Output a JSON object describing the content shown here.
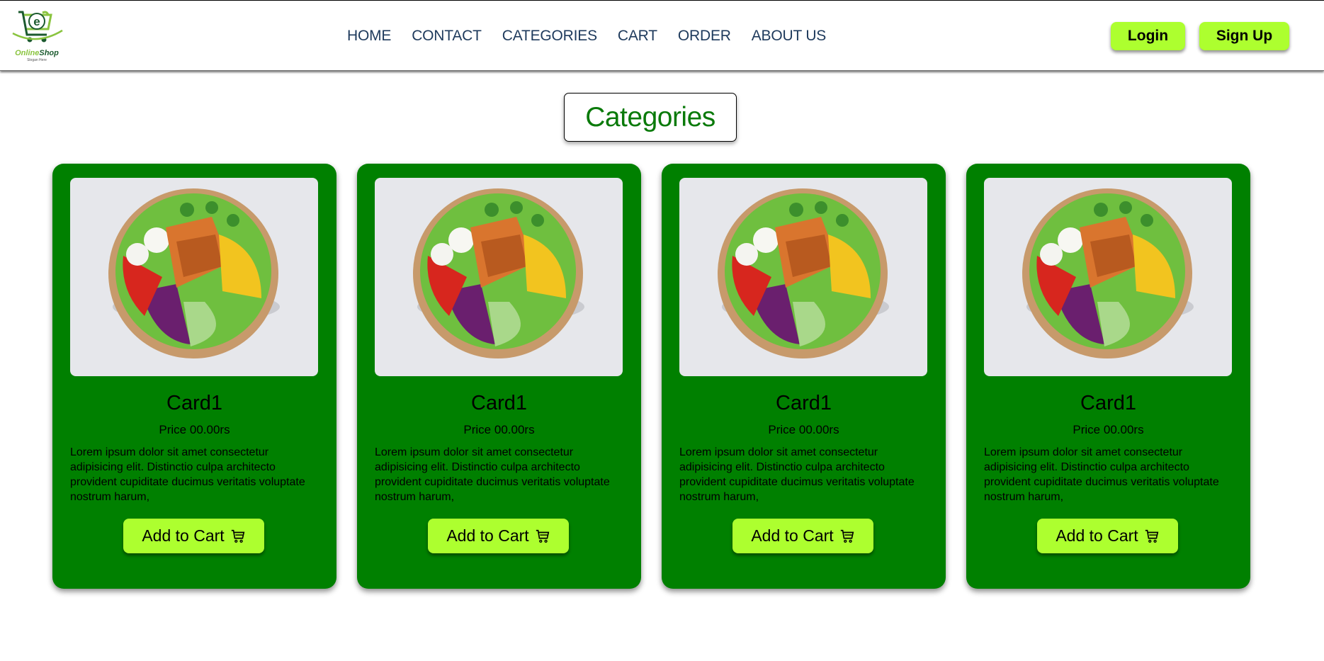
{
  "brand": {
    "name_part1": "Online",
    "name_part2": "Shop",
    "slogan": "Slogan Here",
    "logo_letter": "e"
  },
  "nav": {
    "links": [
      "HOME",
      "CONTACT",
      "CATEGORIES",
      "CART",
      "ORDER",
      "ABOUT US"
    ],
    "login_label": "Login",
    "signup_label": "Sign Up"
  },
  "section": {
    "title": "Categories"
  },
  "cards": [
    {
      "title": "Card1",
      "price": "Price 00.00rs",
      "description": "Lorem ipsum dolor sit amet consectetur adipisicing elit. Distinctio culpa architecto provident cupiditate ducimus veritatis voluptate nostrum harum,",
      "button_label": "Add to Cart",
      "button_icon": "cart-icon"
    },
    {
      "title": "Card1",
      "price": "Price 00.00rs",
      "description": "Lorem ipsum dolor sit amet consectetur adipisicing elit. Distinctio culpa architecto provident cupiditate ducimus veritatis voluptate nostrum harum,",
      "button_label": "Add to Cart",
      "button_icon": "cart-icon"
    },
    {
      "title": "Card1",
      "price": "Price 00.00rs",
      "description": "Lorem ipsum dolor sit amet consectetur adipisicing elit. Distinctio culpa architecto provident cupiditate ducimus veritatis voluptate nostrum harum,",
      "button_label": "Add to Cart",
      "button_icon": "cart-icon"
    },
    {
      "title": "Card1",
      "price": "Price 00.00rs",
      "description": "Lorem ipsum dolor sit amet consectetur adipisicing elit. Distinctio culpa architecto provident cupiditate ducimus veritatis voluptate nostrum harum,",
      "button_label": "Add to Cart",
      "button_icon": "cart-icon"
    }
  ],
  "colors": {
    "card_bg": "#008000",
    "button_bg": "#adff2f",
    "title_green": "#0a7a0a",
    "nav_text": "#1e3a5c"
  }
}
